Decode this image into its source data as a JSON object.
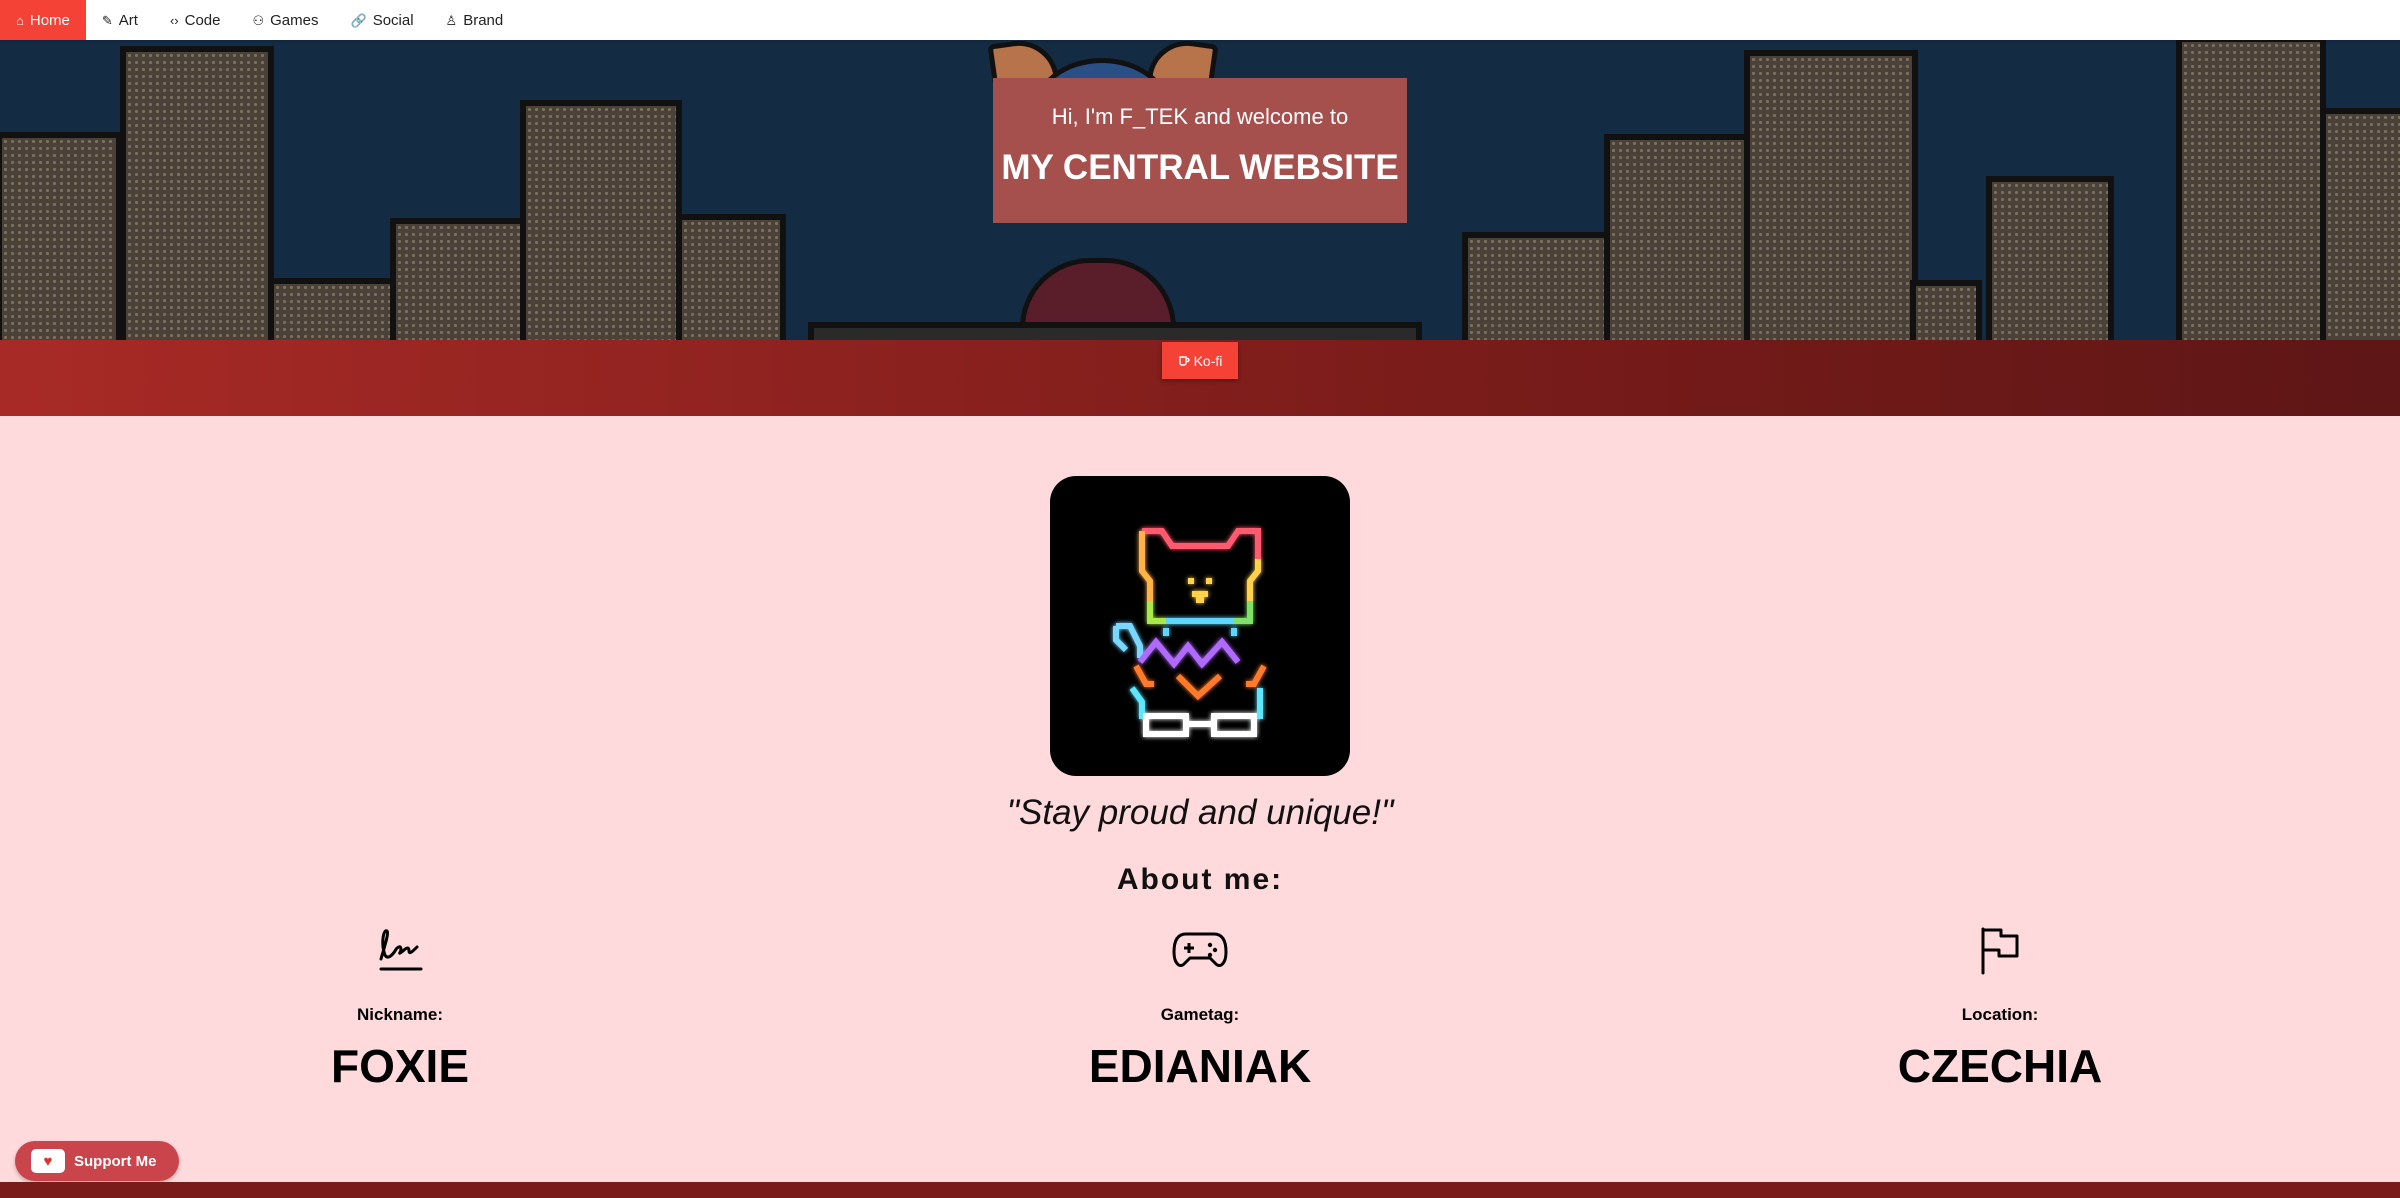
{
  "nav": {
    "items": [
      {
        "label": "Home",
        "icon": "home-icon",
        "glyph": "⌂"
      },
      {
        "label": "Art",
        "icon": "pencil-icon",
        "glyph": "✎"
      },
      {
        "label": "Code",
        "icon": "code-icon",
        "glyph": "‹›"
      },
      {
        "label": "Games",
        "icon": "gamepad-icon",
        "glyph": "⚇"
      },
      {
        "label": "Social",
        "icon": "link-icon",
        "glyph": "🔗"
      },
      {
        "label": "Brand",
        "icon": "user-icon",
        "glyph": "♙"
      }
    ]
  },
  "hero": {
    "subtitle": "Hi, I'm F_TEK and welcome to",
    "title": "MY CENTRAL WEBSITE"
  },
  "kofi": {
    "label": "Ko-fi",
    "icon": "cup-icon"
  },
  "quote": "\"Stay proud and unique!\"",
  "about": {
    "heading": "About me:",
    "items": [
      {
        "label": "Nickname:",
        "value": "FOXIE",
        "icon": "signature-icon"
      },
      {
        "label": "Gametag:",
        "value": "EDIANIAK",
        "icon": "gamepad-icon"
      },
      {
        "label": "Location:",
        "value": "CZECHIA",
        "icon": "flag-icon"
      }
    ]
  },
  "support": {
    "label": "Support Me",
    "icon": "kofi-cup-icon"
  },
  "colors": {
    "accent": "#f44336",
    "page_bg": "#ffdadc",
    "band": "#8e221f",
    "hero_box": "#a6504e",
    "hero_bg": "#142b44"
  }
}
